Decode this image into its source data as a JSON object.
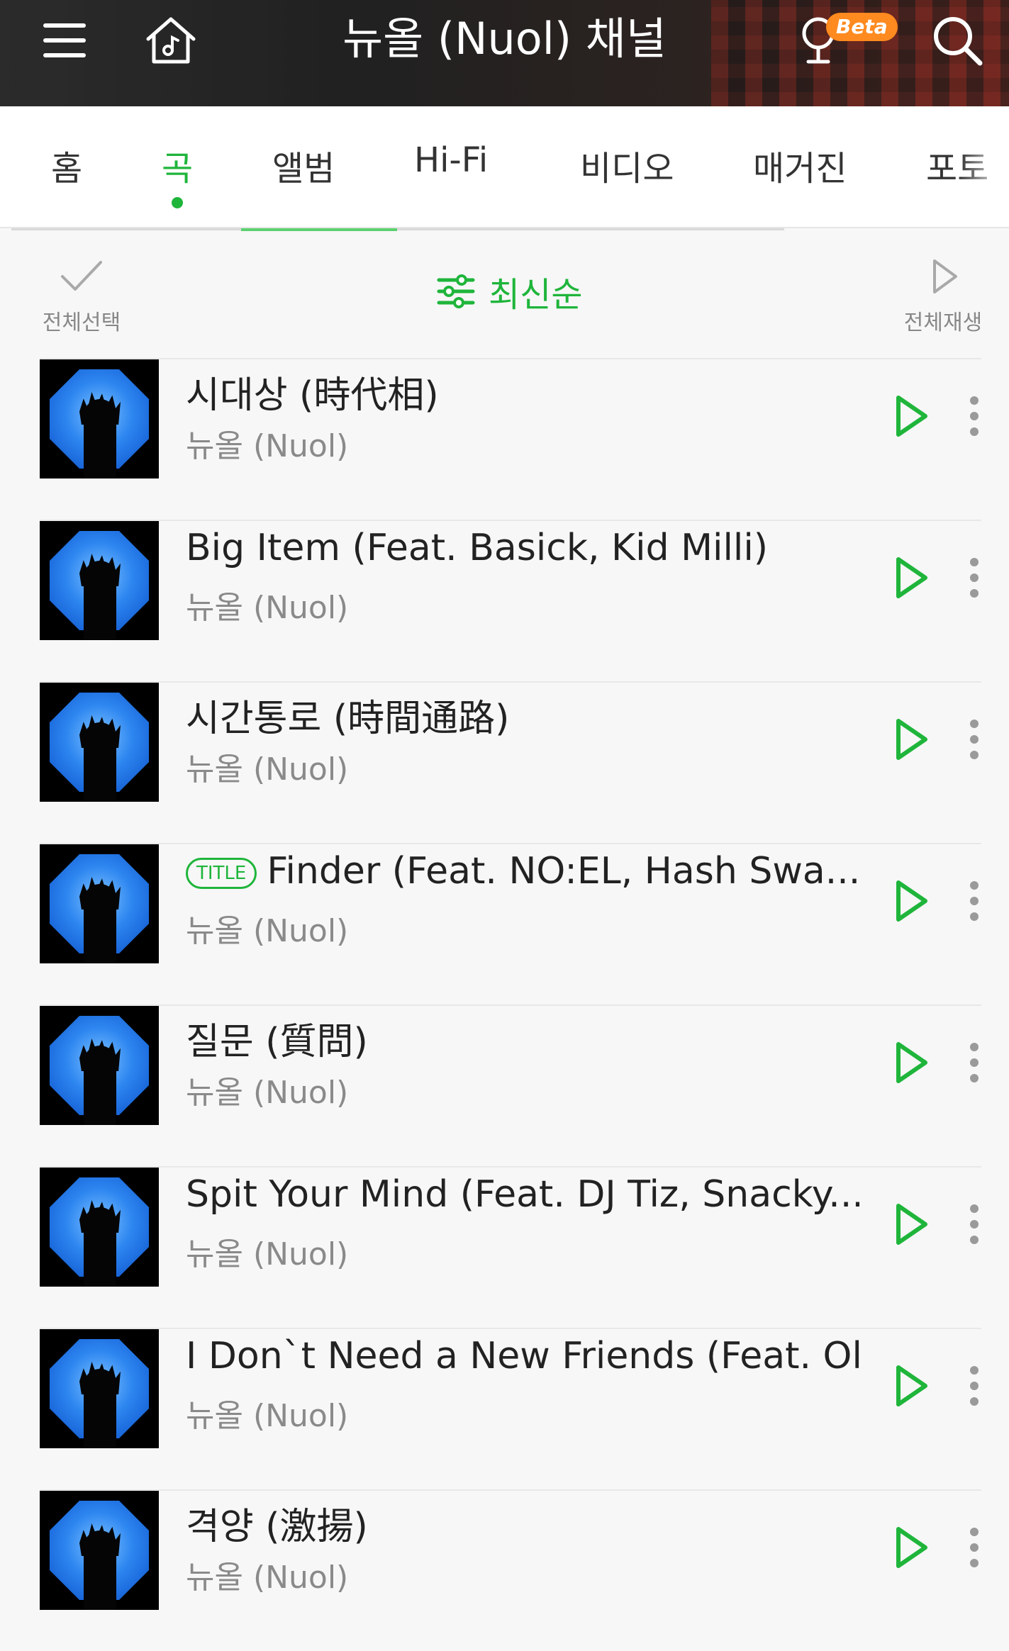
{
  "header": {
    "title": "뉴올 (Nuol) 채널",
    "beta_label": "Beta",
    "icons": [
      "menu-icon",
      "home-music-icon",
      "music-recognition-icon",
      "search-icon"
    ]
  },
  "tabs": [
    {
      "label": "홈",
      "active": false
    },
    {
      "label": "곡",
      "active": true
    },
    {
      "label": "앨범",
      "active": false
    },
    {
      "label": "Hi-Fi",
      "active": false
    },
    {
      "label": "비디오",
      "active": false
    },
    {
      "label": "매거진",
      "active": false
    },
    {
      "label": "포토",
      "active": false
    }
  ],
  "toolbar": {
    "select_all_label": "전체선택",
    "sort_label": "최신순",
    "play_all_label": "전체재생"
  },
  "songs": [
    {
      "title": "시대상 (時代相)",
      "artist": "뉴올 (Nuol)",
      "badge": ""
    },
    {
      "title": "Big Item (Feat. Basick, Kid Milli)",
      "artist": "뉴올 (Nuol)",
      "badge": ""
    },
    {
      "title": "시간통로 (時間通路)",
      "artist": "뉴올 (Nuol)",
      "badge": ""
    },
    {
      "title": "Finder (Feat. NO:EL, Hash Swa...",
      "artist": "뉴올 (Nuol)",
      "badge": "TITLE"
    },
    {
      "title": "질문 (質問)",
      "artist": "뉴올 (Nuol)",
      "badge": ""
    },
    {
      "title": "Spit Your Mind (Feat. DJ Tiz, Snacky...",
      "artist": "뉴올 (Nuol)",
      "badge": ""
    },
    {
      "title": "I Don`t Need a New Friends (Feat. Ol...",
      "artist": "뉴올 (Nuol)",
      "badge": ""
    },
    {
      "title": "격양 (激揚)",
      "artist": "뉴올 (Nuol)",
      "badge": ""
    }
  ],
  "colors": {
    "accent": "#1fb53b",
    "beta": "#ff8a1f"
  }
}
